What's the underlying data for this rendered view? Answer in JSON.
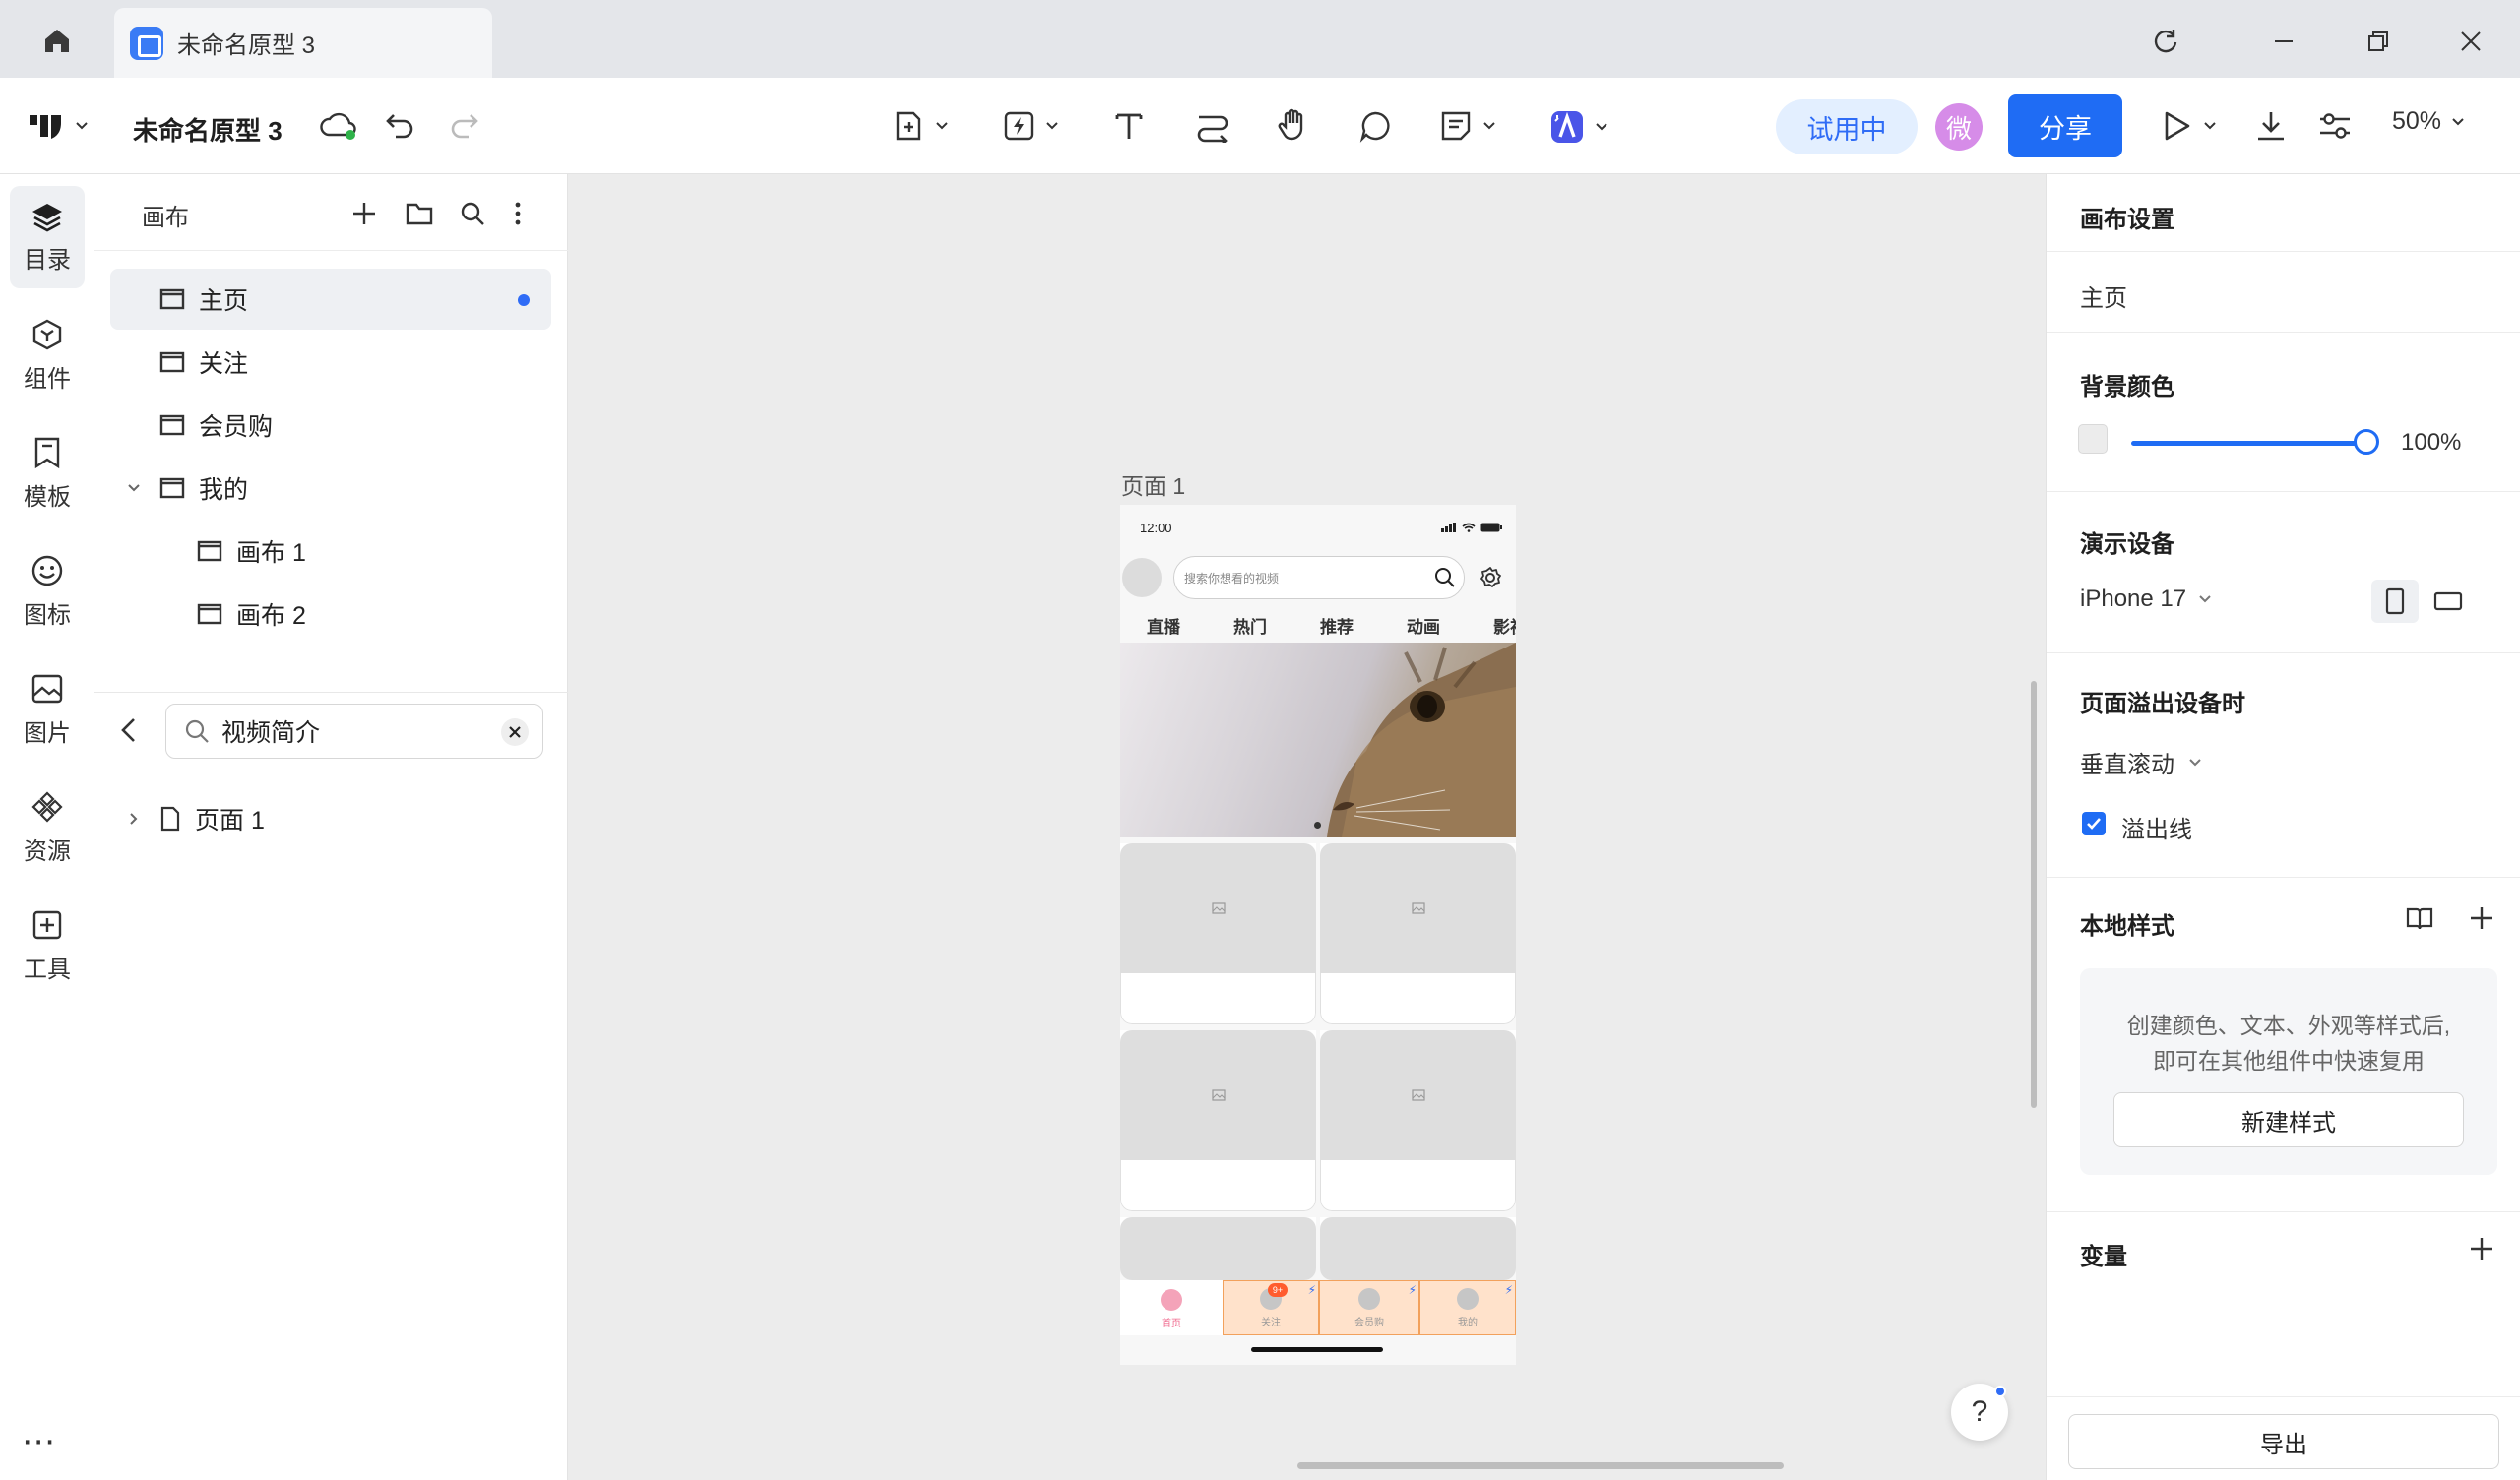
{
  "tab": {
    "title": "未命名原型 3"
  },
  "toolbar": {
    "project_name": "未命名原型 3",
    "trial_label": "试用中",
    "avatar_text": "微",
    "share_label": "分享",
    "zoom_label": "50%"
  },
  "rail": {
    "items": [
      {
        "label": "目录",
        "icon": "layers-icon"
      },
      {
        "label": "组件",
        "icon": "component-icon"
      },
      {
        "label": "模板",
        "icon": "template-icon"
      },
      {
        "label": "图标",
        "icon": "smiley-icon"
      },
      {
        "label": "图片",
        "icon": "image-icon"
      },
      {
        "label": "资源",
        "icon": "resource-icon"
      },
      {
        "label": "工具",
        "icon": "tool-icon"
      }
    ],
    "more": "⋯"
  },
  "layers": {
    "title": "画布",
    "pages": [
      {
        "label": "主页"
      },
      {
        "label": "关注"
      },
      {
        "label": "会员购"
      },
      {
        "label": "我的"
      },
      {
        "label": "画布 1"
      },
      {
        "label": "画布 2"
      }
    ],
    "search_value": "视频简介",
    "result": "页面 1"
  },
  "canvas": {
    "frame_label": "页面 1",
    "phone": {
      "time": "12:00",
      "search_placeholder": "搜索你想看的视频",
      "tabs": [
        "直播",
        "热门",
        "推荐",
        "动画",
        "影视"
      ],
      "tabbar": [
        {
          "label": "首页"
        },
        {
          "label": "关注",
          "badge": "9+"
        },
        {
          "label": "会员购"
        },
        {
          "label": "我的"
        }
      ]
    },
    "help": "?"
  },
  "props": {
    "canvas_settings": "画布设置",
    "page_name": "主页",
    "bg_title": "背景颜色",
    "bg_opacity": "100%",
    "device_title": "演示设备",
    "device_value": "iPhone 17",
    "overflow_title": "页面溢出设备时",
    "overflow_value": "垂直滚动",
    "overflow_line": "溢出线",
    "local_style_title": "本地样式",
    "style_hint_1": "创建颜色、文本、外观等样式后,",
    "style_hint_2": "即可在其他组件中快速复用",
    "new_style": "新建样式",
    "variables_title": "变量",
    "export": "导出"
  },
  "colors": {
    "accent": "#1f6cf4",
    "trial_bg": "#e3efff",
    "avatar": "#d68ce8"
  }
}
